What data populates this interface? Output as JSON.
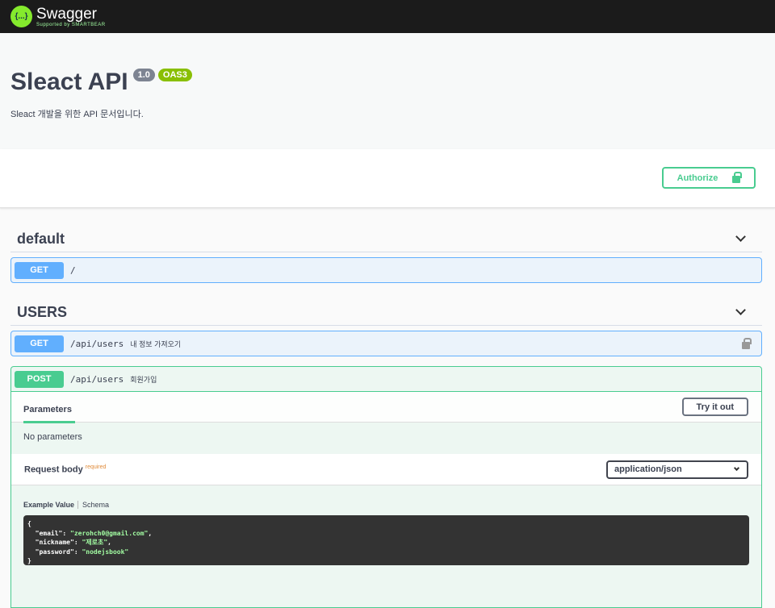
{
  "topbar": {
    "logo_glyph": "{...}",
    "brand": "Swagger",
    "supported": "Supported by SMARTBEAR"
  },
  "info": {
    "title": "Sleact API",
    "version": "1.0",
    "oas": "OAS3",
    "description": "Sleact 개발을 위한 API 문서입니다."
  },
  "authorize_label": "Authorize",
  "tags": [
    {
      "name": "default",
      "ops": [
        {
          "method": "GET",
          "path": "/",
          "summary": ""
        }
      ]
    },
    {
      "name": "USERS",
      "ops": [
        {
          "method": "GET",
          "path": "/api/users",
          "summary": "내 정보 가져오기"
        },
        {
          "method": "POST",
          "path": "/api/users",
          "summary": "회원가입"
        }
      ]
    }
  ],
  "post_panel": {
    "parameters_tab": "Parameters",
    "try_label": "Try it out",
    "no_params": "No parameters",
    "request_body": "Request body",
    "required": "required",
    "content_type": "application/json",
    "example_tab": "Example Value",
    "schema_tab": "Schema",
    "example": {
      "open": "{",
      "close": "}",
      "email_key": "\"email\"",
      "email_val": "\"zerohch0@gmail.com\"",
      "nickname_key": "\"nickname\"",
      "nickname_val": "\"제로초\"",
      "password_key": "\"password\"",
      "password_val": "\"nodejsbook\""
    }
  },
  "colors": {
    "get": "#61affe",
    "post": "#49cc90",
    "topbar": "#1b1b1b"
  }
}
